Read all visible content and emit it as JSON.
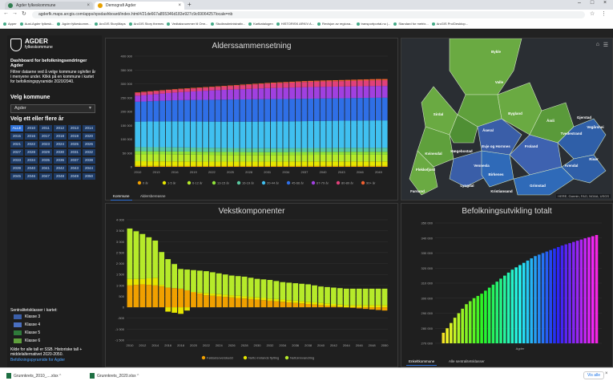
{
  "browser": {
    "tabs": [
      {
        "label": "Agder fylkeskommune",
        "color": "#2f7d4f"
      },
      {
        "label": "Demografi Agder",
        "color": "#e6a000"
      }
    ],
    "url": "agderfk.maps.arcgis.com/apps/opsdashboard/index.html#/21de667a855346d183e927c9c69064257locale=nb",
    "bookmarks": [
      "Apper",
      "Aust-Agder fylkesk...",
      "Agder fylkeskomm...",
      "ArcGIS StoryMaps",
      "ArcGIS Story themes",
      "Vedtaksnummer til Omr...",
      "Studieadministrativ...",
      "Kartkatalogen",
      "HISTORISK ARKIV A...",
      "Revisjon av regiona...",
      "transportportal.no |...",
      "Standard for metrix...",
      "ArcGIS Pro/Desktop..."
    ]
  },
  "sidebar": {
    "logo_title": "AGDER",
    "logo_subtitle": "fylkeskommune",
    "heading": "Dashboard for befolkningsendringer Agder",
    "description": "Filtrer dataene ved å velge kommune og/eller år i menyene under. Klikk på en kommune i kartet for befolkningspyramide 2020/2040.",
    "kommune_label": "Velg kommune",
    "kommune_value": "Agder",
    "year_label": "Velg ett eller flere år",
    "years": [
      "ALLE",
      "2010",
      "2011",
      "2012",
      "2013",
      "2014",
      "2015",
      "2016",
      "2017",
      "2018",
      "2019",
      "2020",
      "2021",
      "2022",
      "2023",
      "2024",
      "2025",
      "2026",
      "2027",
      "2028",
      "2029",
      "2030",
      "2031",
      "2032",
      "2033",
      "2034",
      "2035",
      "2036",
      "2037",
      "2038",
      "2039",
      "2040",
      "2041",
      "2042",
      "2043",
      "2044",
      "2045",
      "2046",
      "2047",
      "2048",
      "2049",
      "2050"
    ],
    "legend_title": "Sentralitetsklasser i kartet:",
    "legend_items": [
      {
        "label": "Klasse 3",
        "color": "#3a5ea8"
      },
      {
        "label": "Klasse 4",
        "color": "#4a6fc0"
      },
      {
        "label": "Klasse 5",
        "color": "#2f7a3a"
      },
      {
        "label": "Klasse 6",
        "color": "#5fa03c"
      }
    ],
    "source_text": "Kilde for alle tall er SSB. Historiske tall + middelalternativet 2020-2050.",
    "link_text": "Befolkningspyramide for Agder"
  },
  "panels": {
    "age_title": "Alderssammensetning",
    "age_tabs": [
      "Kommune",
      "Aldersbereasne"
    ],
    "growth_title": "Vekstkomponenter",
    "total_title": "Befolkningsutvikling totalt",
    "total_tabs": [
      "Enkeltkommune",
      "Alle sentralitetsklasser"
    ],
    "total_xlabel": "Agder"
  },
  "map": {
    "labels": [
      "Bykle",
      "Valle",
      "Bygland",
      "Åmli",
      "Sirdal",
      "Åseral",
      "Evje og Hornnes",
      "Froland",
      "Tvedestrand",
      "Kvinesdal",
      "Vennesla",
      "Birkenes",
      "Grimstad",
      "Flekkefjord",
      "Lyngdal",
      "Kristiansand",
      "Arendal",
      "Risør",
      "Gjerstad",
      "Vegårshei",
      "Hægebostad",
      "Farsund"
    ],
    "attribution": "HERE, Garmin, FAO, NOAA, USGS"
  },
  "chart_data": [
    {
      "type": "bar",
      "title": "Alderssammensetning",
      "stacked": true,
      "x": [
        "2010",
        "2013",
        "2016",
        "2019",
        "2022",
        "2025",
        "2028",
        "2031",
        "2034",
        "2037",
        "2040",
        "2043",
        "2046",
        "2049"
      ],
      "ylim": [
        0,
        400000
      ],
      "yticks": [
        "0",
        "50 000",
        "100 000",
        "150 000",
        "200 000",
        "250 000",
        "300 000",
        "350 000",
        "400 000"
      ],
      "series": [
        {
          "name": "0 år",
          "color": "#f0a000",
          "values": [
            3300,
            3200,
            3100,
            3000,
            3000,
            3000,
            3000,
            3000,
            3000,
            3100,
            3100,
            3100,
            3100,
            3100
          ]
        },
        {
          "name": "1-5 år",
          "color": "#e6e600",
          "values": [
            17000,
            16800,
            16600,
            16300,
            16000,
            16000,
            16000,
            16100,
            16200,
            16300,
            16400,
            16400,
            16400,
            16400
          ]
        },
        {
          "name": "6-12 år",
          "color": "#b6ea2a",
          "values": [
            25000,
            25000,
            24800,
            24600,
            24200,
            23900,
            23700,
            23600,
            23700,
            23900,
            24000,
            24100,
            24200,
            24200
          ]
        },
        {
          "name": "13-15 år",
          "color": "#8fe23a",
          "values": [
            11000,
            11000,
            11000,
            11000,
            11000,
            10800,
            10600,
            10500,
            10400,
            10500,
            10600,
            10700,
            10700,
            10700
          ]
        },
        {
          "name": "16-19 år",
          "color": "#5ac8a0",
          "values": [
            15000,
            15000,
            15000,
            14800,
            14600,
            14500,
            14400,
            14300,
            14200,
            14200,
            14300,
            14400,
            14400,
            14400
          ]
        },
        {
          "name": "20-44 år",
          "color": "#40c0f0",
          "values": [
            92000,
            93000,
            94000,
            94000,
            94500,
            95000,
            95500,
            96000,
            96500,
            97000,
            97500,
            98000,
            98500,
            99000
          ]
        },
        {
          "name": "45-66 år",
          "color": "#2f6fe6",
          "values": [
            72000,
            74000,
            76000,
            78000,
            79000,
            80000,
            80500,
            81000,
            81000,
            81000,
            81000,
            81000,
            81500,
            82000
          ]
        },
        {
          "name": "67-79 år",
          "color": "#a040e0",
          "values": [
            22000,
            25000,
            28000,
            31000,
            34000,
            36000,
            38000,
            40000,
            41000,
            42000,
            42500,
            42500,
            42500,
            42500
          ]
        },
        {
          "name": "80-89 år",
          "color": "#e0407a",
          "values": [
            10000,
            10000,
            10200,
            10500,
            11000,
            12500,
            14500,
            16000,
            17500,
            18500,
            19000,
            19500,
            20000,
            20500
          ]
        },
        {
          "name": "90+ år",
          "color": "#f06030",
          "values": [
            2000,
            2000,
            2100,
            2200,
            2300,
            2400,
            2500,
            2700,
            3000,
            3300,
            3600,
            3900,
            4200,
            4500
          ]
        }
      ]
    },
    {
      "type": "bar",
      "title": "Vekstkomponenter",
      "stacked": true,
      "x": [
        "2010",
        "2012",
        "2014",
        "2016",
        "2018",
        "2020",
        "2022",
        "2024",
        "2026",
        "2028",
        "2030",
        "2032",
        "2034",
        "2036",
        "2038",
        "2040",
        "2042",
        "2044",
        "2046",
        "2048",
        "2050"
      ],
      "ylim": [
        -1500,
        4000
      ],
      "yticks": [
        "-1 500",
        "-1 000",
        "-500",
        "0",
        "500",
        "1 000",
        "1 500",
        "2 000",
        "2 500",
        "3 000",
        "3 500",
        "4 000"
      ],
      "series": [
        {
          "name": "Fødselsoverskudd",
          "color": "#f0a000",
          "values": [
            1000,
            1050,
            1000,
            900,
            850,
            700,
            550,
            500,
            450,
            400,
            350,
            300,
            250,
            200,
            150,
            100,
            50,
            0,
            -50,
            -100,
            -150
          ]
        },
        {
          "name": "Netto innlands flytting",
          "color": "#e6e600",
          "values": [
            300,
            250,
            350,
            -200,
            -300,
            0,
            100,
            100,
            100,
            100,
            100,
            100,
            100,
            100,
            100,
            100,
            100,
            100,
            100,
            100,
            100
          ]
        },
        {
          "name": "Nettoinnvandring",
          "color": "#b6ea2a",
          "values": [
            2300,
            2050,
            1700,
            1300,
            900,
            1000,
            1000,
            950,
            900,
            900,
            850,
            850,
            800,
            800,
            800,
            750,
            750,
            750,
            750,
            750,
            750
          ]
        }
      ]
    },
    {
      "type": "bar",
      "title": "Befolkningsutvikling totalt",
      "x": [
        "2010",
        "2011",
        "2012",
        "2013",
        "2014",
        "2015",
        "2016",
        "2017",
        "2018",
        "2019",
        "2020",
        "2021",
        "2022",
        "2023",
        "2024",
        "2025",
        "2026",
        "2027",
        "2028",
        "2029",
        "2030",
        "2031",
        "2032",
        "2033",
        "2034",
        "2035",
        "2036",
        "2037",
        "2038",
        "2039",
        "2040",
        "2041",
        "2042",
        "2043",
        "2044",
        "2045",
        "2046",
        "2047",
        "2048",
        "2049",
        "2050"
      ],
      "xlabel": "Agder",
      "ylim": [
        270000,
        350000
      ],
      "yticks": [
        "270 000",
        "280 000",
        "290 000",
        "300 000",
        "310 000",
        "320 000",
        "330 000",
        "340 000",
        "350 000"
      ],
      "values": [
        277000,
        280000,
        283500,
        287000,
        290000,
        293000,
        296000,
        298000,
        300000,
        301500,
        303000,
        305000,
        307000,
        309000,
        311000,
        313000,
        315000,
        317000,
        319000,
        320500,
        322000,
        323500,
        325000,
        326500,
        328000,
        329000,
        330000,
        331000,
        332000,
        333000,
        334000,
        335000,
        335800,
        336600,
        337400,
        338200,
        339000,
        339800,
        340500,
        341200,
        342000
      ]
    }
  ]
}
